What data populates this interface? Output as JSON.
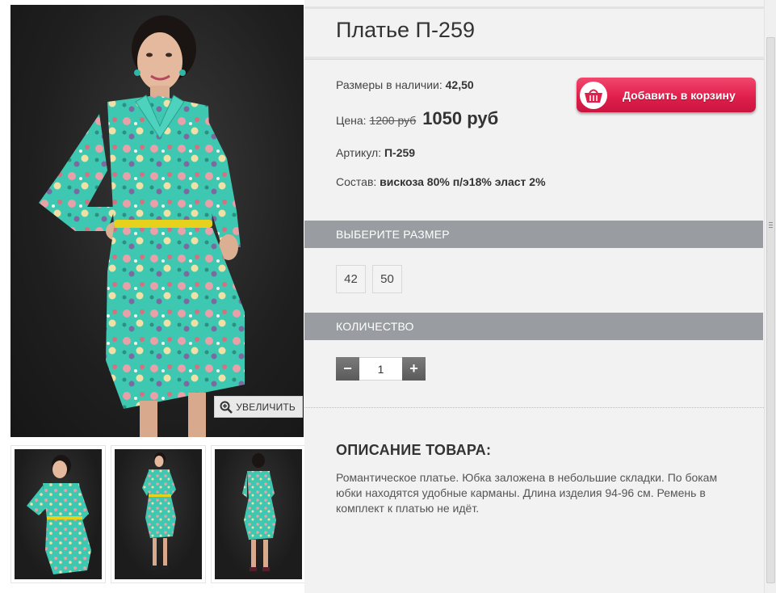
{
  "product": {
    "title": "Платье П-259",
    "sizes_label": "Размеры в наличии:",
    "sizes_value": "42,50",
    "price_label": "Цена:",
    "price_old": "1200 руб",
    "price_new": "1050 руб",
    "sku_label": "Артикул:",
    "sku_value": "П-259",
    "composition_label": "Состав:",
    "composition_value": "вискоза 80% п/э18% эласт 2%"
  },
  "cart_button": {
    "label": "Добавить в корзину",
    "icon": "shopping-basket-icon"
  },
  "gallery": {
    "zoom_label": "УВЕЛИЧИТЬ",
    "zoom_icon": "magnifier-plus-icon",
    "thumbnails": [
      "front-view",
      "full-length-front-view",
      "back-view"
    ]
  },
  "size_selector": {
    "heading": "ВЫБЕРИТЕ РАЗМЕР",
    "options": [
      "42",
      "50"
    ]
  },
  "quantity": {
    "heading": "КОЛИЧЕСТВО",
    "minus": "−",
    "plus": "+",
    "value": "1"
  },
  "description": {
    "heading": "ОПИСАНИЕ ТОВАРА:",
    "text": "Романтическое платье. Юбка заложена в небольшие складки. По бокам юбки находятся удобные карманы. Длина изделия 94-96 см. Ремень в комплект к платью не идёт."
  },
  "colors": {
    "accent_cart": "#e01f4c",
    "section_bar": "#999ca1",
    "panel_bg": "#f2f2f2",
    "dress_turquoise": "#3cc7b0",
    "belt_yellow": "#e6d21d"
  }
}
